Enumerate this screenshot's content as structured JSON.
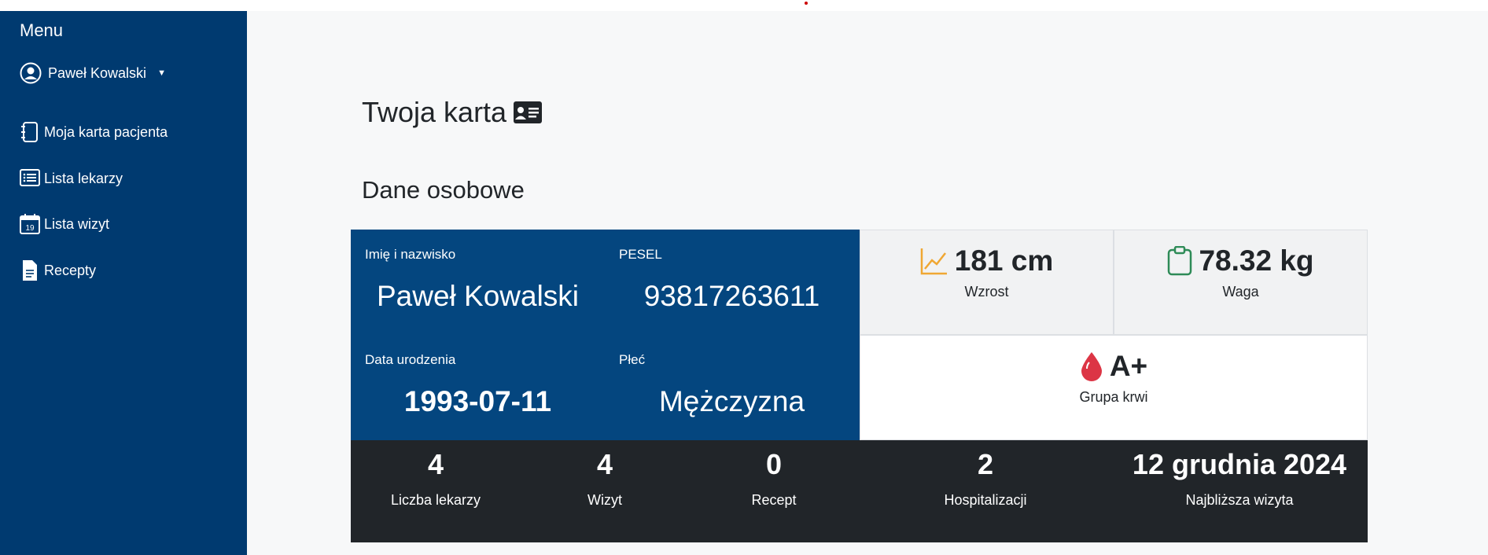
{
  "sidebar": {
    "menu_title": "Menu",
    "user_name": "Paweł Kowalski",
    "items": [
      {
        "label": "Moja karta pacjenta",
        "icon": "notebook-icon"
      },
      {
        "label": "Lista lekarzy",
        "icon": "list-icon"
      },
      {
        "label": "Lista wizyt",
        "icon": "calendar-icon"
      },
      {
        "label": "Recepty",
        "icon": "document-icon"
      }
    ],
    "calendar_day": "19"
  },
  "main": {
    "title": "Twoja karta",
    "section": "Dane osobowe"
  },
  "personal": {
    "name_label": "Imię i nazwisko",
    "name_value": "Paweł Kowalski",
    "pesel_label": "PESEL",
    "pesel_value": "93817263611",
    "birth_label": "Data urodzenia",
    "birth_value": "1993-07-11",
    "sex_label": "Płeć",
    "sex_value": "Mężczyzna"
  },
  "metrics": {
    "height_value": "181 cm",
    "height_label": "Wzrost",
    "weight_value": "78.32 kg",
    "weight_label": "Waga",
    "blood_value": "A+",
    "blood_label": "Grupa krwi"
  },
  "stats": [
    {
      "value": "4",
      "label": "Liczba lekarzy"
    },
    {
      "value": "4",
      "label": "Wizyt"
    },
    {
      "value": "0",
      "label": "Recept"
    },
    {
      "value": "2",
      "label": "Hospitalizacji"
    },
    {
      "value": "12 grudnia 2024",
      "label": "Najbliższa wizyta"
    }
  ],
  "colors": {
    "sidebar": "#003a70",
    "personal_panel": "#04467f",
    "stats_bar": "#212529",
    "height_icon": "#f0a733",
    "weight_icon": "#2e8b57",
    "blood_icon": "#dc3545"
  }
}
